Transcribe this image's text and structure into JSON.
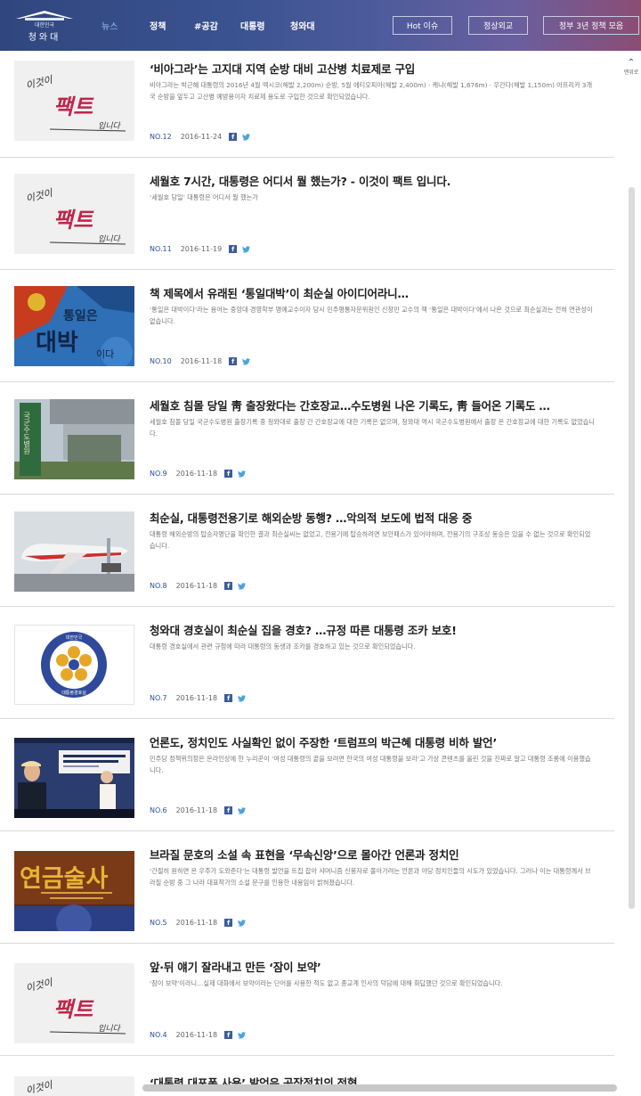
{
  "header": {
    "logo_small": "대한민국",
    "logo_main": "청와대",
    "nav": [
      "뉴스",
      "정책",
      "#공감",
      "대통령",
      "청와대"
    ],
    "buttons": [
      "Hot 이슈",
      "정상외교",
      "정부 3년 정책 모음"
    ]
  },
  "side": {
    "top_label": "맨위로"
  },
  "thumb_text": {
    "fact_1": "이것이",
    "fact_2": "팩트",
    "fact_3": "입니다",
    "book_1": "통일은",
    "book_2": "대박",
    "book_3": "이다",
    "hospital": "국군수도병원",
    "emblem_top": "대한민국",
    "emblem_bottom": "대통령경호실",
    "occult": "연금술사"
  },
  "items": [
    {
      "title": "‘비아그라’는 고지대 지역 순방 대비 고산병 치료제로 구입",
      "desc": "비아그라는 박근혜 대통령의 2016년 4월 멕시코(해발 2,200m) 순방, 5월 에티오피아(해발 2,400m) · 케냐(해발 1,676m) · 우간다(해발 1,150m) 아프리카 3개국 순방을 앞두고 고산병 예방용이자 치료제 용도로 구입한 것으로 확인되었습니다.",
      "num": "NO.12",
      "date": "2016-11-24"
    },
    {
      "title": "세월호 7시간, 대통령은 어디서 뭘 했는가? - 이것이 팩트 입니다.",
      "desc": "‘세월호 당일’ 대통령은 어디서 뭘 했는가",
      "num": "NO.11",
      "date": "2016-11-19"
    },
    {
      "title": "책 제목에서 유래된 ‘통일대박’이 최순실 아이디어라니…",
      "desc": "‘통일은 대박이다’라는 용어는 중앙대 경영학부 명예교수이자 당시 민주평통자문위원인 신창민 교수의 책 ‘통일은 대박이다’에서 나온 것으로 최순실과는 전혀 연관성이 없습니다.",
      "num": "NO.10",
      "date": "2016-11-18"
    },
    {
      "title": "세월호 침몰 당일 靑 출장왔다는 간호장교…수도병원 나온 기록도, 靑 들어온 기록도 …",
      "desc": "세월호 침몰 당일 국군수도병원 출장기록 중 청와대로 출장 간 간호장교에 대한 기록은 없으며, 청와대 역시 국군수도병원에서 출장 온 간호장교에 대한 기록도 없었습니다.",
      "num": "NO.9",
      "date": "2016-11-18"
    },
    {
      "title": "최순실, 대통령전용기로 해외순방 동행? …악의적 보도에 법적 대응 중",
      "desc": "대통령 해외순방의 탑승자명단을 확인한 결과 최순실씨는 없었고, 전용기에 탑승하려면 보안패스가 있어야하며, 전용기의 구조상 동승은 있을 수 없는 것으로 확인되었습니다.",
      "num": "NO.8",
      "date": "2016-11-18"
    },
    {
      "title": "청와대 경호실이 최순실 집을 경호? …규정 따른 대통령 조카 보호!",
      "desc": "대통령 경호실에서 관련 규정에 따라 대통령의 동생과 조카를 경호하고 있는 것으로 확인되었습니다.",
      "num": "NO.7",
      "date": "2016-11-18"
    },
    {
      "title": "언론도, 정치인도 사실확인 없이 주장한 ‘트럼프의 박근혜 대통령 비하 발언’",
      "desc": "민주당 정책위의장은 온라인상에 한 누리꾼이 ‘여성 대통령의 끝을 보려면 한국의 여성 대통령을 보라’고 가상 콘텐츠를 올린 것을 진짜로 알고 대통령 조롱에 이용했습니다.",
      "num": "NO.6",
      "date": "2016-11-18"
    },
    {
      "title": "브라질 문호의 소설 속 표현을 ‘무속신앙’으로 몰아간 언론과 정치인",
      "desc": "‘간절히 원하면 온 우주가 도와준다’는 대통령 발언을 트집 잡아 샤머니즘 신봉자로 몰아가려는 언론과 야당 정치인들의 시도가 있었습니다. 그러나 이는 대통령께서 브라질 순방 중 그 나라 대표작가의 소설 문구를 인용한 내용임이 밝혀졌습니다.",
      "num": "NO.5",
      "date": "2016-11-18"
    },
    {
      "title": "앞·뒤 얘기 잘라내고 만든 ‘잠이 보약’",
      "desc": "‘잠이 보약’이라니…실제 대화에서 보약이라는 단어를 사용한 적도 없고 종교계 인사의 덕담에 대해 화답했던 것으로 확인되었습니다.",
      "num": "NO.4",
      "date": "2016-11-18"
    },
    {
      "title": "‘대통령 대포폰 사용’ 발언은 공작정치의 전형",
      "desc": "",
      "num": "",
      "date": ""
    }
  ],
  "colors": {
    "header_start": "#30467f",
    "header_end": "#8b4d74",
    "number": "#2a4f9a",
    "facebook": "#3b5b9e",
    "twitter": "#4aa3df"
  },
  "icons": [
    "facebook-icon",
    "twitter-icon",
    "chevron-up-icon"
  ]
}
